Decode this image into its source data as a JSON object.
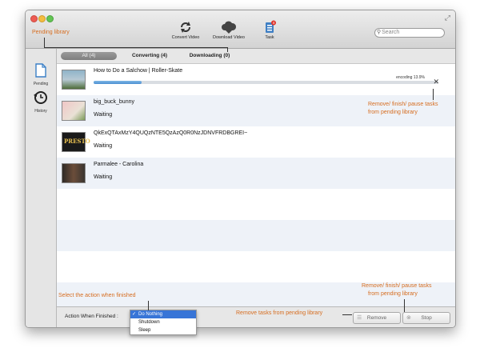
{
  "toolbar": {
    "convert_label": "Convert Video",
    "download_label": "Download Video",
    "task_label": "Task",
    "task_badge": "4",
    "search_placeholder": "Search"
  },
  "tabs": [
    {
      "label": "All (4)",
      "active": true
    },
    {
      "label": "Converting (4)",
      "active": false
    },
    {
      "label": "Downloading (0)",
      "active": false
    }
  ],
  "sidebar": {
    "items": [
      {
        "label": "Pending",
        "icon": "document-icon"
      },
      {
        "label": "History",
        "icon": "history-clock-icon"
      }
    ]
  },
  "tasks": [
    {
      "title": "How to Do a Salchow | Roller-Skate",
      "status": "",
      "progress_text": "encoding 13.9%",
      "progress": 0.139
    },
    {
      "title": "big_buck_bunny",
      "status": "Waiting"
    },
    {
      "title": "QkExQTAxMzY4QUQzNTE5QzAzQ0R0NzJDNVFRDBGREI~",
      "status": "Waiting",
      "thumb_text": "PRESTO"
    },
    {
      "title": "Parmalee - Carolina",
      "status": "Waiting"
    }
  ],
  "bottom": {
    "action_label": "Action When Finished :",
    "options": [
      "Do Nothing",
      "Shutdown",
      "Sleep"
    ],
    "selected": "Do Nothing",
    "remove_label": "Remove",
    "stop_label": "Stop"
  },
  "annotations": {
    "pending_library": "Pending library",
    "remove_finish_pause_1": "Remove/ finish/ pause tasks",
    "remove_finish_pause_2": "from pending library",
    "select_action": "Select the action when finished",
    "remove_finish_pause_b1": "Remove/ finish/ pause tasks",
    "remove_finish_pause_b2": "from pending library",
    "remove_tasks": "Remove tasks from pending library"
  },
  "colors": {
    "annotation": "#d66d20",
    "progress": "#4c90d2",
    "selected": "#3875d7"
  }
}
